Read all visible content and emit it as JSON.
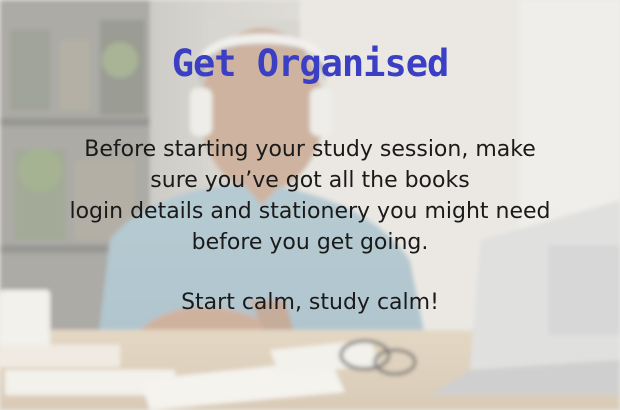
{
  "slide": {
    "title": "Get Organised",
    "body_lines": [
      "Before starting your study session, make",
      "sure you’ve got all the books",
      "login details and stationery you might need",
      "before you get going."
    ],
    "closing": "Start calm, study calm!"
  },
  "colors": {
    "title": "#3b3fc4",
    "text": "#1a1a1a",
    "overlay": "#eeece8"
  },
  "background_image": "man-with-headphones-studying-at-desk-photo"
}
